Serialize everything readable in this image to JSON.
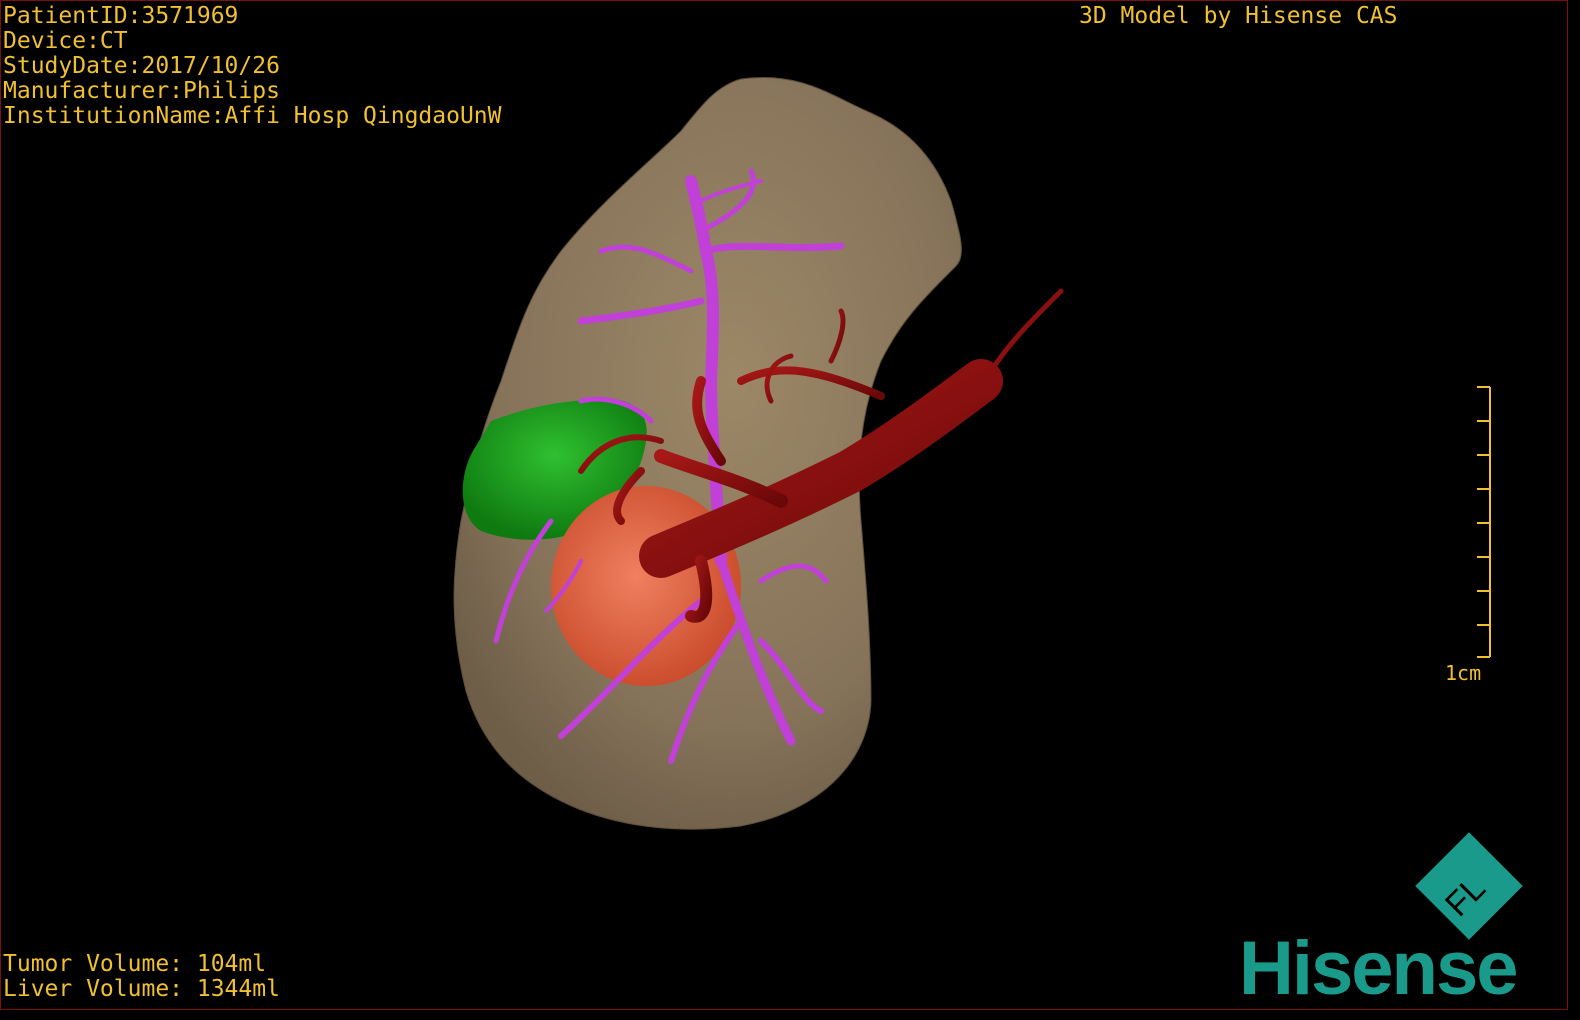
{
  "header": {
    "patient_id": "PatientID:3571969",
    "device": "Device:CT",
    "study_date": "StudyDate:2017/10/26",
    "manufacturer": "Manufacturer:Philips",
    "institution": "InstitutionName:Affi Hosp QingdaoUnW",
    "credit": "3D Model by Hisense CAS"
  },
  "footer": {
    "tumor_volume": "Tumor Volume: 104ml",
    "liver_volume": "Liver Volume: 1344ml"
  },
  "scale": {
    "label": "1cm"
  },
  "logo": {
    "brand": "Hisense",
    "emblem": "FL"
  },
  "colors": {
    "text": "#f0c030",
    "liver": "#8a7758",
    "tumor": "#e8603a",
    "gallbladder": "#1a9a1a",
    "hepatic_vein": "#c040d8",
    "portal_vein": "#8a0e0e",
    "brand": "#1a9a8a",
    "border": "#7a1010"
  },
  "icons": [
    "liver-model-icon",
    "hisense-fl-logo-icon"
  ]
}
